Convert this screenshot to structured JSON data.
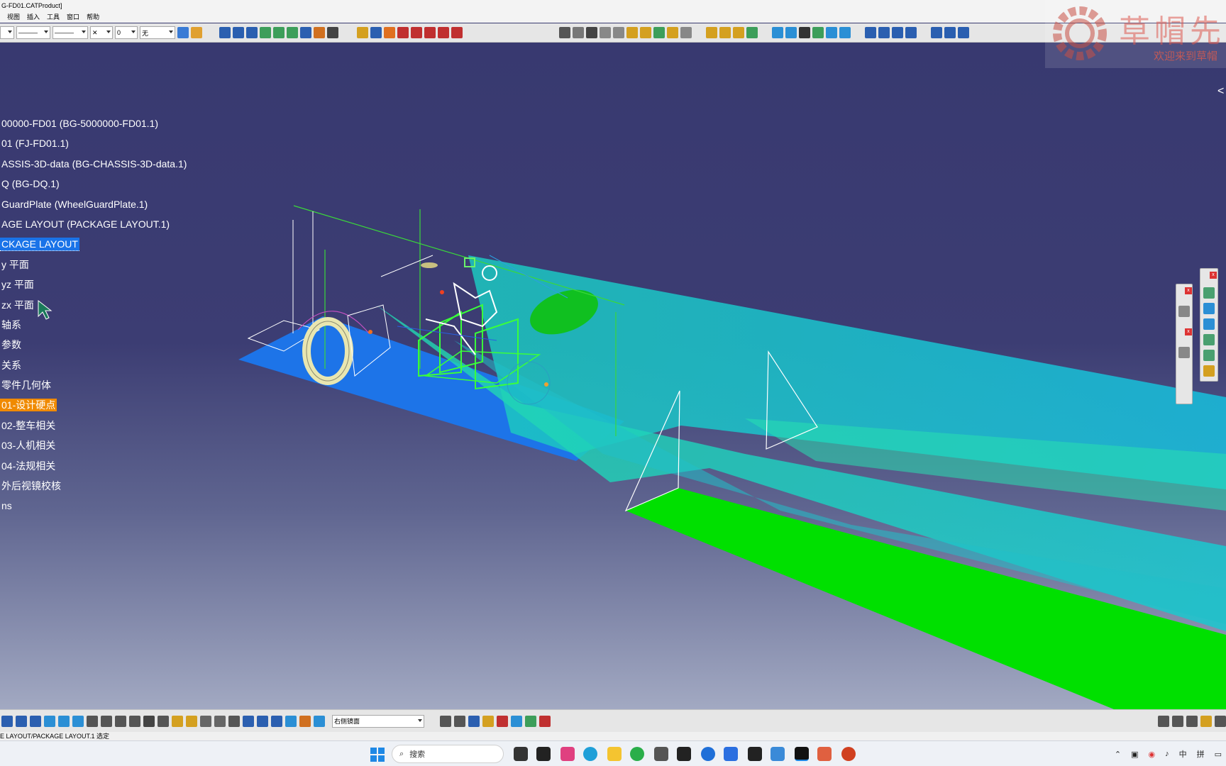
{
  "window": {
    "title": "G-FD01.CATProduct]"
  },
  "menu": {
    "items": [
      "视图",
      "插入",
      "工具",
      "窗口",
      "帮助"
    ]
  },
  "toolbar": {
    "line_style_combo": "———",
    "line_weight_combo": "———",
    "point_combo": "✕",
    "layer_combo": "0",
    "render_combo": "无"
  },
  "tree": {
    "items": [
      {
        "label": "00000-FD01 (BG-5000000-FD01.1)",
        "state": "normal"
      },
      {
        "label": "01 (FJ-FD01.1)",
        "state": "normal"
      },
      {
        "label": "ASSIS-3D-data (BG-CHASSIS-3D-data.1)",
        "state": "normal"
      },
      {
        "label": "Q (BG-DQ.1)",
        "state": "normal"
      },
      {
        "label": "GuardPlate (WheelGuardPlate.1)",
        "state": "normal"
      },
      {
        "label": "AGE LAYOUT (PACKAGE LAYOUT.1)",
        "state": "normal"
      },
      {
        "label": "CKAGE LAYOUT",
        "state": "selected"
      },
      {
        "label": "y 平面",
        "state": "normal"
      },
      {
        "label": "yz 平面",
        "state": "normal"
      },
      {
        "label": "zx 平面",
        "state": "normal"
      },
      {
        "label": "轴系",
        "state": "normal"
      },
      {
        "label": "参数",
        "state": "normal"
      },
      {
        "label": "关系",
        "state": "normal"
      },
      {
        "label": "零件几何体",
        "state": "normal"
      },
      {
        "label": "01-设计硬点",
        "state": "highlight"
      },
      {
        "label": "02-整车相关",
        "state": "normal"
      },
      {
        "label": "03-人机相关",
        "state": "normal"
      },
      {
        "label": "04-法规相关",
        "state": "normal"
      },
      {
        "label": "外后视镜校核",
        "state": "normal"
      },
      {
        "label": "ns",
        "state": "normal"
      }
    ]
  },
  "bottom_toolbar": {
    "view_combo": "右侧镜面"
  },
  "status": {
    "text": "E LAYOUT/PACKAGE LAYOUT.1 选定"
  },
  "taskbar": {
    "search_placeholder": "搜索",
    "tray_items": [
      "中",
      "拼"
    ]
  },
  "watermark": {
    "title": "草帽先",
    "subtitle": "欢迎来到草帽"
  },
  "colors": {
    "viewport_top": "#383970",
    "selected": "#1a73e8",
    "highlight": "#f08a00",
    "cyan_volume": "#19d2d2",
    "green_plane": "#00e000",
    "blue_plane": "#1d74e8"
  }
}
